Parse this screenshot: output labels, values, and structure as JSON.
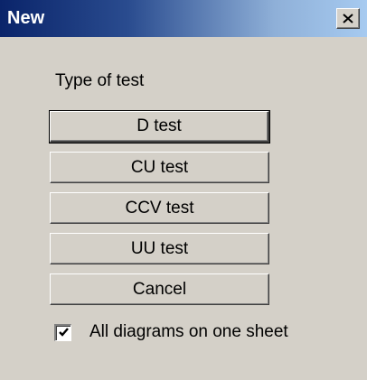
{
  "window": {
    "title": "New",
    "close_icon": "close-icon"
  },
  "dialog": {
    "section_label": "Type of test",
    "buttons": {
      "d_test": "D test",
      "cu_test": "CU test",
      "ccv_test": "CCV test",
      "uu_test": "UU test",
      "cancel": "Cancel"
    },
    "checkbox": {
      "label": "All diagrams on one sheet",
      "checked": true,
      "icon": "checkmark-icon"
    }
  },
  "colors": {
    "title_gradient_start": "#0a246a",
    "title_gradient_end": "#a6caf0",
    "face": "#d4d0c8"
  }
}
